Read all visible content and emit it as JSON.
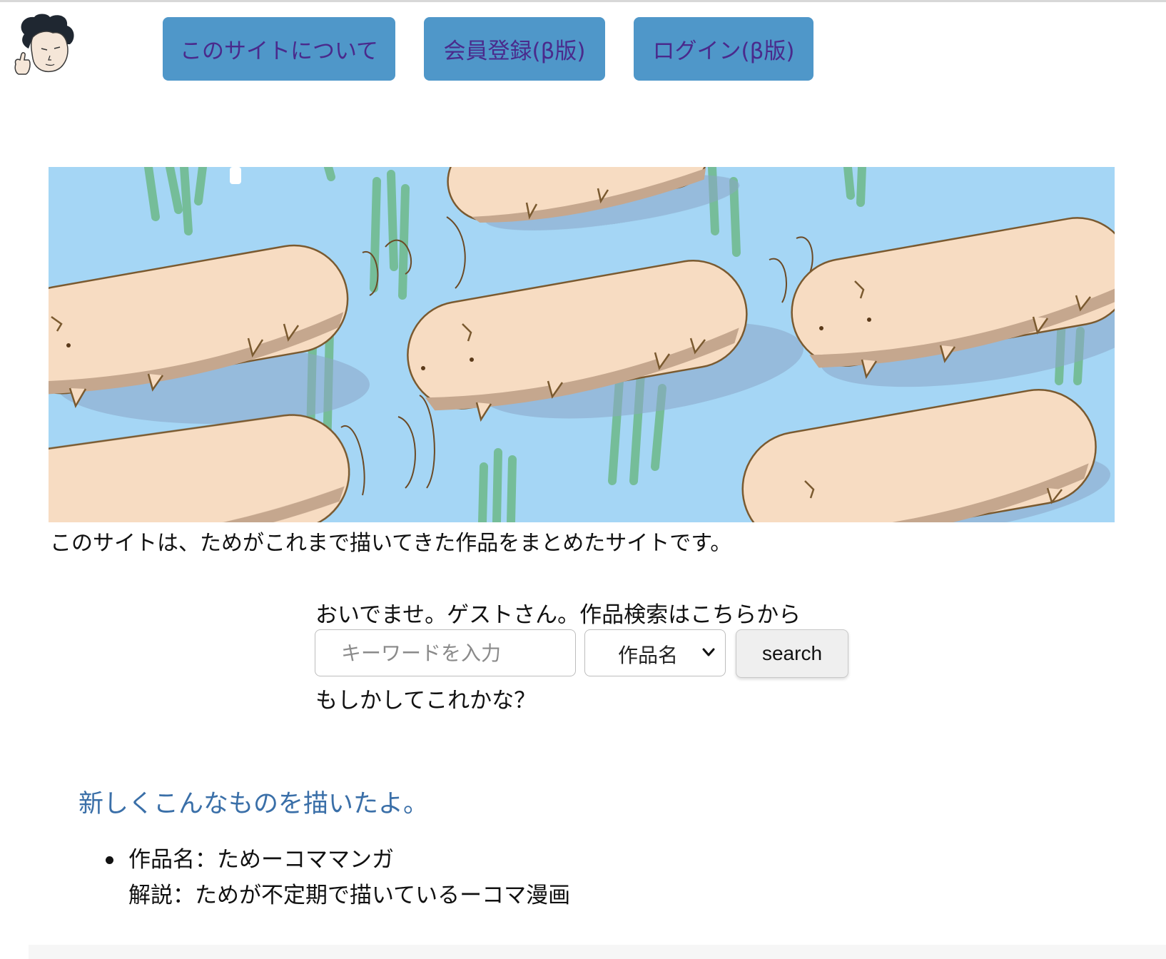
{
  "nav": {
    "about": "このサイトについて",
    "register": "会員登録(β版)",
    "login": "ログイン(β版)"
  },
  "intro": "このサイトは、ためがこれまで描いてきた作品をまとめたサイトです。",
  "search": {
    "welcome": "おいでませ。ゲストさん。作品検索はこちらから",
    "placeholder": "キーワードを入力",
    "select_value": "作品名",
    "button": "search",
    "suggestion": "もしかしてこれかな？"
  },
  "new_section": {
    "heading": "新しくこんなものを描いたよ。",
    "items": [
      {
        "title": "作品名：ためーコママンガ",
        "description": "解説：ためが不定期で描いているーコマ漫画"
      }
    ]
  },
  "colors": {
    "nav_button_bg": "#4f97c9",
    "nav_button_text": "#4a2a8c",
    "heading": "#3a6fa8",
    "hero_sky": "#a5d6f5",
    "creature_body": "#f7dcc2",
    "creature_belly": "#c5a78e",
    "grass": "#6db98a"
  }
}
